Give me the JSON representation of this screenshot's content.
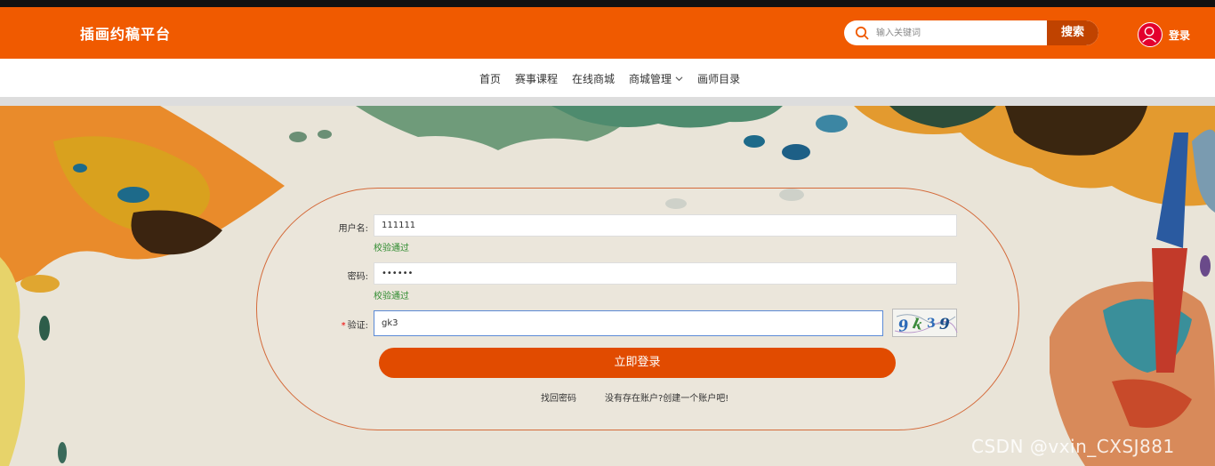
{
  "header": {
    "brand": "插画约稿平台",
    "search_placeholder": "输入关键词",
    "search_button": "搜索",
    "login": "登录"
  },
  "nav": {
    "items": [
      "首页",
      "赛事课程",
      "在线商城",
      "商城管理",
      "画师目录"
    ]
  },
  "form": {
    "username_label": "用户名:",
    "username_value": "111111",
    "username_status": "校验通过",
    "password_label": "密码:",
    "password_value": "••••••",
    "password_status": "校验通过",
    "captcha_required": "*",
    "captcha_label": "验证:",
    "captcha_value": "gk3",
    "captcha_image_text": "9k39",
    "submit": "立即登录",
    "forgot": "找回密码",
    "register": "没有存在账户?创建一个账户吧!"
  },
  "watermark": "CSDN @vxin_CXSJ881",
  "colors": {
    "header": "#f05a00",
    "button": "#e14b00",
    "ok": "#2e8b2e"
  }
}
